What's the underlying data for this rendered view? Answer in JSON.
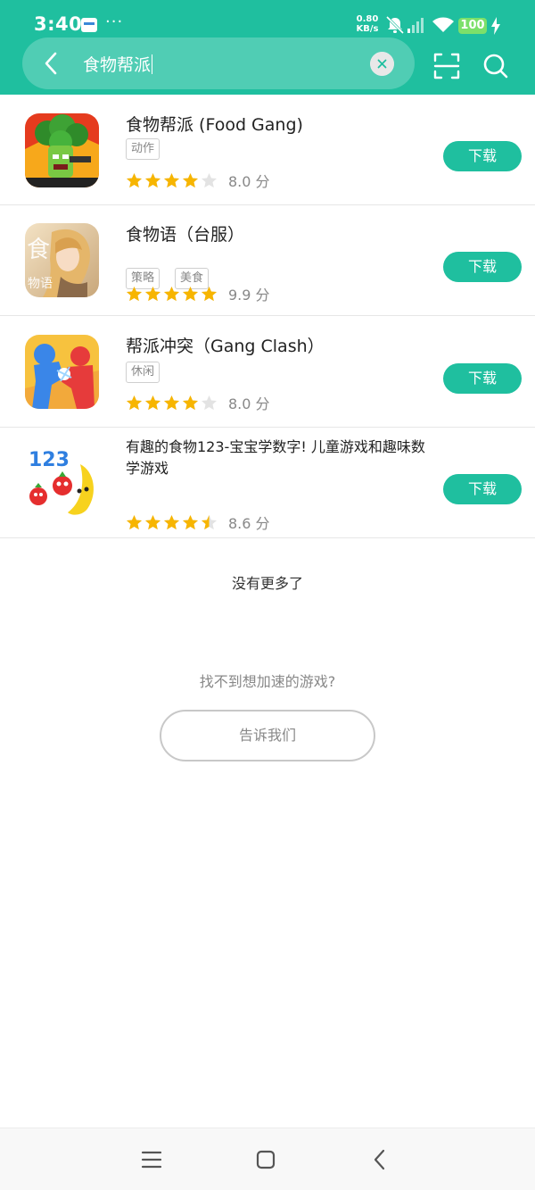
{
  "status_bar": {
    "time": "3:40",
    "dots": "···",
    "speed_value": "0.80",
    "speed_unit": "KB/s",
    "battery": "100"
  },
  "search": {
    "query": "食物帮派"
  },
  "results": [
    {
      "title": "食物帮派 (Food Gang)",
      "tags": [
        "动作"
      ],
      "score": "8.0 分",
      "rating": 4.0,
      "download_label": "下载"
    },
    {
      "title": "食物语（台服）",
      "tags": [
        "策略",
        "美食"
      ],
      "score": "9.9 分",
      "rating": 5.0,
      "download_label": "下载",
      "icon_text": "食",
      "icon_text_small": "物语"
    },
    {
      "title": "帮派冲突（Gang Clash）",
      "tags": [
        "休闲"
      ],
      "score": "8.0 分",
      "rating": 4.0,
      "download_label": "下载"
    },
    {
      "title": "有趣的食物123-宝宝学数字! 儿童游戏和趣味数学游戏",
      "tags": [],
      "score": "8.6 分",
      "rating": 4.5,
      "download_label": "下载",
      "icon_text": "123"
    }
  ],
  "footer": {
    "no_more": "没有更多了",
    "hint": "找不到想加速的游戏?",
    "tell_us": "告诉我们"
  },
  "colors": {
    "accent": "#1fbf9f",
    "star": "#f7b500",
    "star_empty": "#e3e3e3"
  }
}
